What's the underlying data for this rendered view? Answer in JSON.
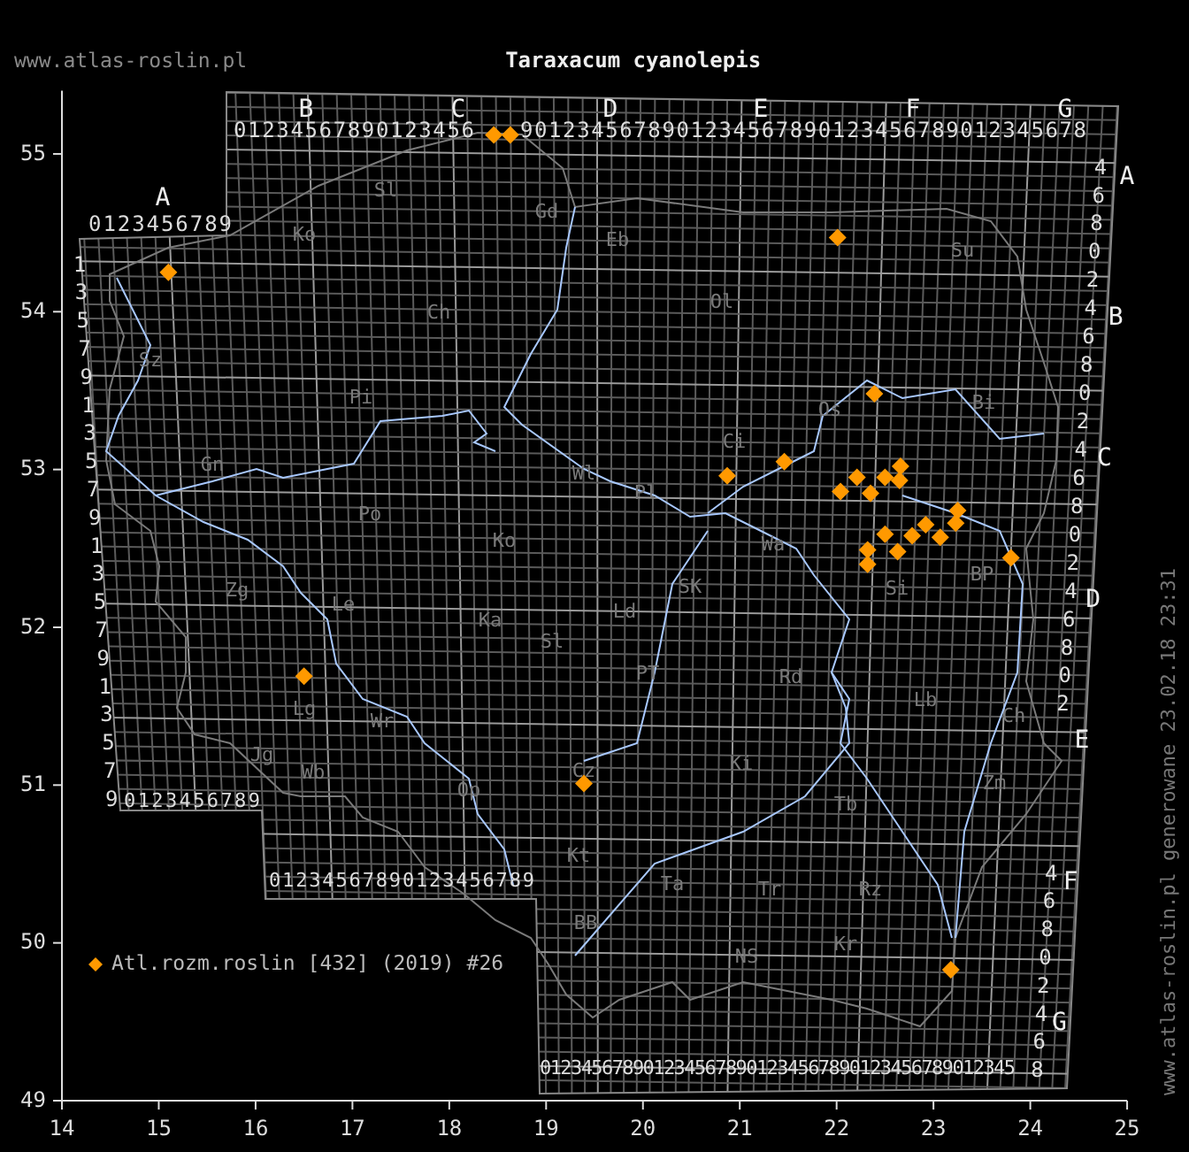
{
  "site": "www.atlas-roslin.pl",
  "title": "Taraxacum cyanolepis",
  "grid_labels": {
    "top_letters": [
      "B",
      "C",
      "D",
      "E",
      "F",
      "G"
    ],
    "top_digits": [
      "01234567890123456",
      "9012345678901234567890123456789012345678"
    ],
    "a_letter": "A",
    "a_digits": "0123456789",
    "left_digits": [
      "1",
      "3",
      "5",
      "7",
      "9",
      "1",
      "3",
      "5",
      "7",
      "9",
      "1",
      "3",
      "5",
      "7",
      "9",
      "1",
      "3",
      "5",
      "7",
      "9"
    ],
    "bottom_left_digits": "0123456789",
    "bottom_mid_digits": "01234567890123456789",
    "bottom_digits": "0123456789012345678901234567890123456789012345",
    "right_letters": [
      "A",
      "B",
      "C",
      "D",
      "E",
      "F",
      "G"
    ],
    "right_digits": [
      "4",
      "6",
      "8",
      "0",
      "2",
      "4",
      "6",
      "8",
      "0",
      "2",
      "4",
      "6",
      "8",
      "0",
      "2",
      "4",
      "6",
      "8",
      "0",
      "2"
    ],
    "right_f_digits": [
      "4",
      "6",
      "8",
      "0",
      "2",
      "4",
      "6",
      "8"
    ]
  },
  "regions": [
    "Sl",
    "Ko",
    "Gd",
    "Eb",
    "Ol",
    "Su",
    "Ch",
    "Sz",
    "Pi",
    "Bi",
    "Os",
    "Ci",
    "Wl",
    "Pl",
    "Gn",
    "Wa",
    "Po",
    "Ko",
    "SK",
    "Si",
    "BP",
    "Zg",
    "Le",
    "Ka",
    "Ld",
    "Sl",
    "PT",
    "Rd",
    "Lb",
    "Lg",
    "Wr",
    "Ch",
    "Jg",
    "Wb",
    "Op",
    "Cz",
    "Ki",
    "Zm",
    "Tb",
    "Kt",
    "Ta",
    "Tr",
    "Rz",
    "BB",
    "NS",
    "Kr"
  ],
  "chart_data": {
    "type": "scatter",
    "xlim": [
      14,
      25
    ],
    "ylim": [
      49,
      55.4
    ],
    "xticks": [
      14,
      15,
      16,
      17,
      18,
      19,
      20,
      21,
      22,
      23,
      24,
      25
    ],
    "yticks": [
      49,
      50,
      51,
      52,
      53,
      54,
      55
    ],
    "x": [
      15.1,
      18.46,
      18.63,
      22.01,
      22.39,
      20.87,
      21.46,
      22.04,
      22.21,
      22.35,
      22.5,
      22.66,
      22.65,
      23.25,
      23.23,
      22.92,
      23.07,
      22.78,
      22.5,
      22.63,
      22.32,
      22.32,
      23.8,
      16.5,
      19.39,
      23.18
    ],
    "series": [
      {
        "name": "Atl.rozm.roslin [432] (2019) #26",
        "color": "#ff9900",
        "values": [
          54.25,
          55.12,
          55.12,
          54.47,
          53.48,
          52.96,
          53.05,
          52.86,
          52.95,
          52.85,
          52.95,
          53.02,
          52.93,
          52.74,
          52.66,
          52.65,
          52.57,
          52.58,
          52.59,
          52.48,
          52.49,
          52.4,
          52.44,
          51.69,
          51.01,
          49.83
        ]
      }
    ]
  },
  "footer": "www.atlas-roslin.pl generowane 23.02.18 23:31"
}
